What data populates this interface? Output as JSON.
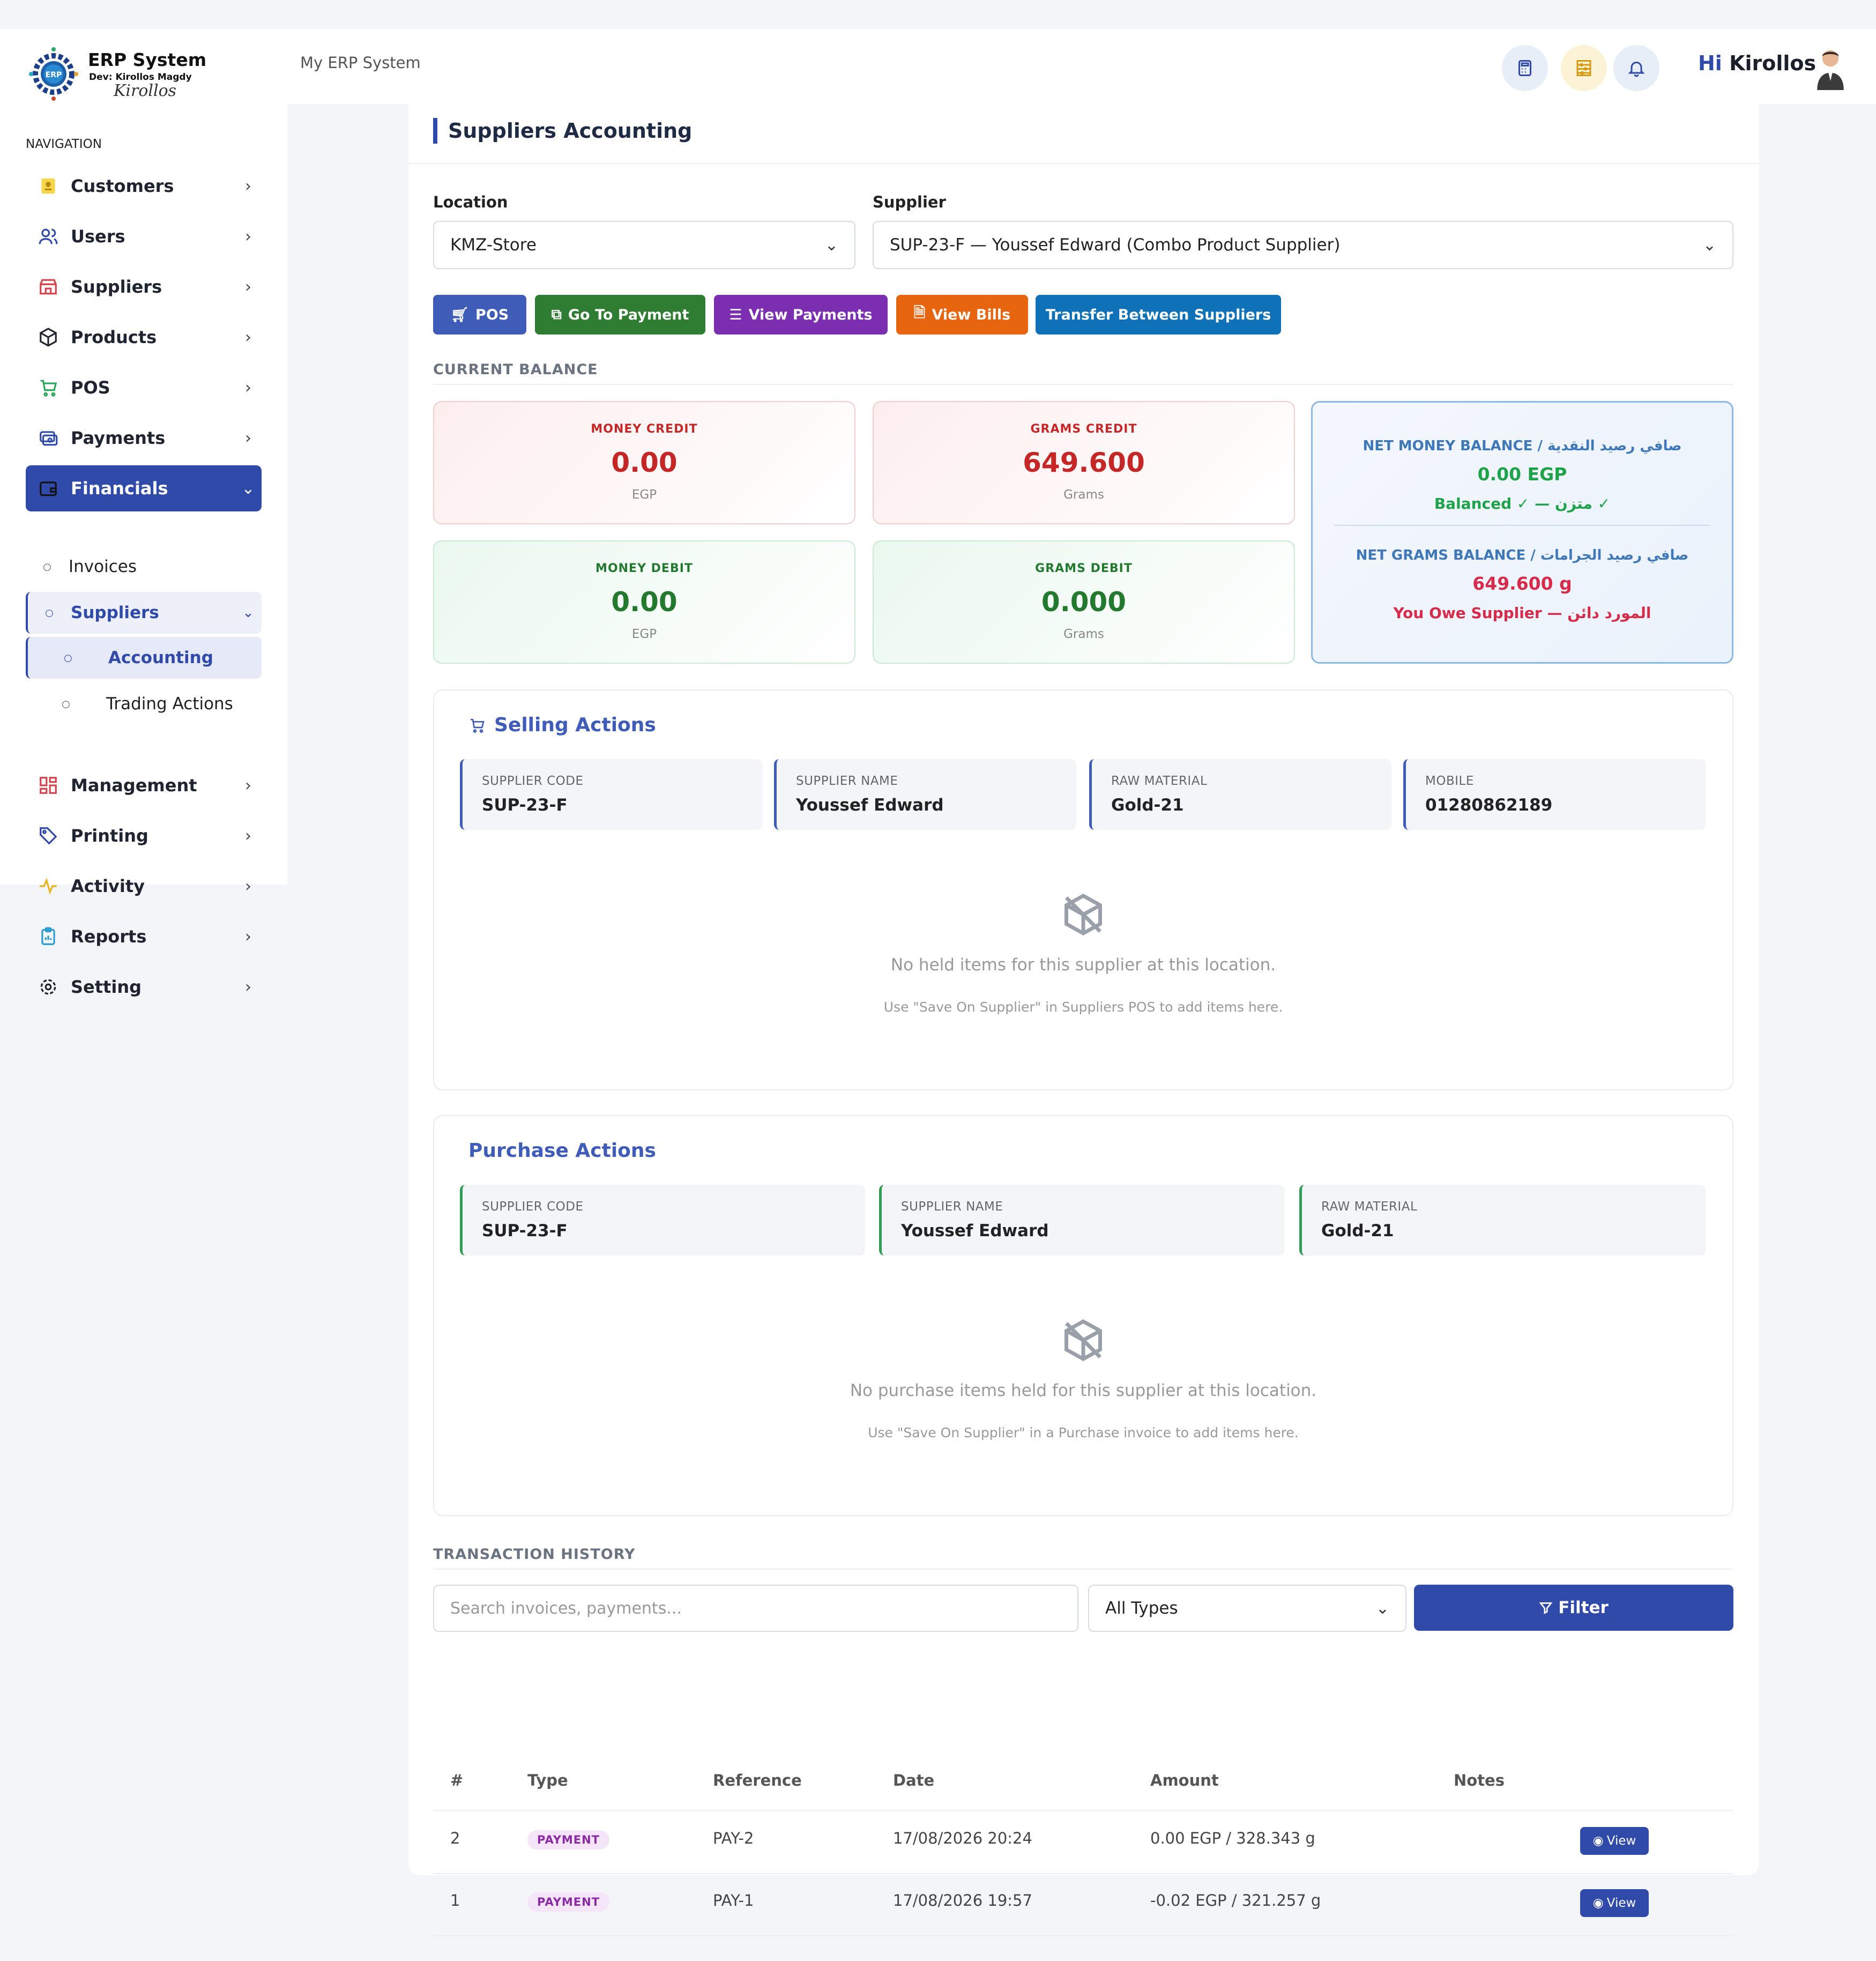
{
  "brand": {
    "title": "ERP System",
    "dev": "Dev: Kirollos Magdy",
    "signature": "Kirollos",
    "logo_text": "ERP"
  },
  "nav": {
    "label": "NAVIGATION",
    "items": [
      {
        "label": "Customers",
        "icon": "customers-icon"
      },
      {
        "label": "Users",
        "icon": "users-icon"
      },
      {
        "label": "Suppliers",
        "icon": "store-icon"
      },
      {
        "label": "Products",
        "icon": "box-icon"
      },
      {
        "label": "POS",
        "icon": "cart-icon"
      },
      {
        "label": "Payments",
        "icon": "payments-icon"
      },
      {
        "label": "Financials",
        "icon": "wallet-icon"
      }
    ],
    "financials_sub": {
      "invoices": "Invoices",
      "suppliers": "Suppliers",
      "accounting": "Accounting",
      "trading": "Trading Actions"
    },
    "lower_items": [
      {
        "label": "Management",
        "icon": "grid-icon"
      },
      {
        "label": "Printing",
        "icon": "tag-icon"
      },
      {
        "label": "Activity",
        "icon": "activity-icon"
      },
      {
        "label": "Reports",
        "icon": "clipboard-icon"
      },
      {
        "label": "Setting",
        "icon": "gear-icon"
      }
    ]
  },
  "topbar": {
    "breadcrumb": "My ERP System",
    "greeting_hi": "Hi",
    "greeting_name": "Kirollos"
  },
  "page": {
    "title": "Suppliers Accounting",
    "location_label": "Location",
    "location_value": "KMZ-Store",
    "supplier_label": "Supplier",
    "supplier_value": "SUP-23-F — Youssef Edward (Combo Product Supplier)"
  },
  "actions": {
    "pos": "POS",
    "go_payment": "Go To Payment",
    "view_payments": "View Payments",
    "view_bills": "View Bills",
    "transfer": "Transfer Between Suppliers"
  },
  "balance": {
    "caption": "CURRENT BALANCE",
    "money_credit": {
      "label": "MONEY CREDIT",
      "value": "0.00",
      "unit": "EGP"
    },
    "grams_credit": {
      "label": "GRAMS CREDIT",
      "value": "649.600",
      "unit": "Grams"
    },
    "money_debit": {
      "label": "MONEY DEBIT",
      "value": "0.00",
      "unit": "EGP"
    },
    "grams_debit": {
      "label": "GRAMS DEBIT",
      "value": "0.000",
      "unit": "Grams"
    },
    "net_money_label": "NET MONEY BALANCE / صافي رصيد النقدية",
    "net_money_value": "0.00 EGP",
    "net_money_status": "Balanced ✓ — متزن ✓",
    "net_grams_label": "NET GRAMS BALANCE / صافي رصيد الجرامات",
    "net_grams_value": "649.600 g",
    "net_grams_status": "You Owe Supplier — المورد دائن"
  },
  "colors": {
    "primary": "#2f4aa8",
    "credit": "#c52727",
    "debit": "#23792e",
    "net_blue": "#3e78b8",
    "green_status": "#1fa34a",
    "red_status": "#d62b4a"
  },
  "selling": {
    "title": "Selling Actions",
    "fields": [
      {
        "label": "SUPPLIER CODE",
        "value": "SUP-23-F"
      },
      {
        "label": "SUPPLIER NAME",
        "value": "Youssef Edward"
      },
      {
        "label": "RAW MATERIAL",
        "value": "Gold-21"
      },
      {
        "label": "MOBILE",
        "value": "01280862189"
      }
    ],
    "empty_main": "No held items for this supplier at this location.",
    "empty_sub": "Use \"Save On Supplier\" in Suppliers POS to add items here."
  },
  "purchase": {
    "title": "Purchase Actions",
    "fields": [
      {
        "label": "SUPPLIER CODE",
        "value": "SUP-23-F"
      },
      {
        "label": "SUPPLIER NAME",
        "value": "Youssef Edward"
      },
      {
        "label": "RAW MATERIAL",
        "value": "Gold-21"
      }
    ],
    "empty_main": "No purchase items held for this supplier at this location.",
    "empty_sub": "Use \"Save On Supplier\" in a Purchase invoice to add items here."
  },
  "history": {
    "caption": "TRANSACTION HISTORY",
    "search_placeholder": "Search invoices, payments...",
    "type_value": "All Types",
    "filter_label": "Filter",
    "columns": [
      "#",
      "Type",
      "Reference",
      "Date",
      "Amount",
      "Notes"
    ],
    "rows": [
      {
        "num": "2",
        "type": "PAYMENT",
        "ref": "PAY-2",
        "date": "17/08/2026 20:24",
        "amount": "0.00 EGP / 328.343 g",
        "notes": "",
        "action": "View"
      },
      {
        "num": "1",
        "type": "PAYMENT",
        "ref": "PAY-1",
        "date": "17/08/2026 19:57",
        "amount": "-0.02 EGP / 321.257 g",
        "notes": "",
        "action": "View"
      }
    ]
  }
}
